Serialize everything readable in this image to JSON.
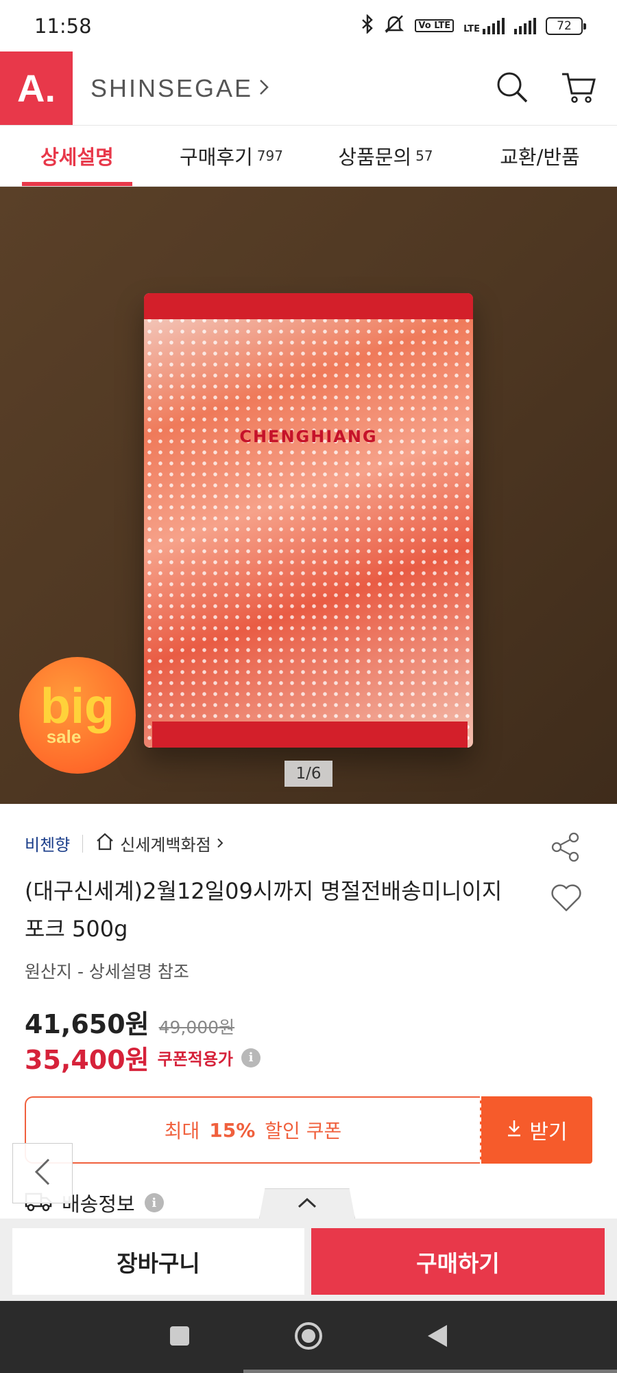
{
  "status_bar": {
    "time": "11:58",
    "volte": "Vo LTE",
    "lte": "LTE",
    "battery": "72"
  },
  "header": {
    "logo": "A.",
    "brand": "SHINSEGAE"
  },
  "tabs": [
    {
      "label": "상세설명",
      "count": "",
      "active": true
    },
    {
      "label": "구매후기",
      "count": "797",
      "active": false
    },
    {
      "label": "상품문의",
      "count": "57",
      "active": false
    },
    {
      "label": "교환/반품",
      "count": "",
      "active": false
    }
  ],
  "hero": {
    "badge_big": "big",
    "badge_sale": "sale",
    "page_indicator": "1/6",
    "bag_text": "CHENGHIANG"
  },
  "product": {
    "brand": "비첸향",
    "store": "신세계백화점",
    "title": "(대구신세계)2월12일09시까지 명절전배송미니이지포크  500g",
    "origin": "원산지 - 상세설명 참조",
    "price": "41,650원",
    "original_price": "49,000원",
    "coupon_price": "35,400원",
    "coupon_price_label": "쿠폰적용가"
  },
  "coupon": {
    "prefix": "최대",
    "percent": "15%",
    "suffix": "할인 쿠폰",
    "button": "받기"
  },
  "shipping": {
    "label": "배송정보"
  },
  "bottom": {
    "cart": "장바구니",
    "buy": "구매하기"
  },
  "colors": {
    "accent": "#e8384a",
    "coupon": "#f65b2b",
    "brand_link": "#1b3e8a"
  }
}
